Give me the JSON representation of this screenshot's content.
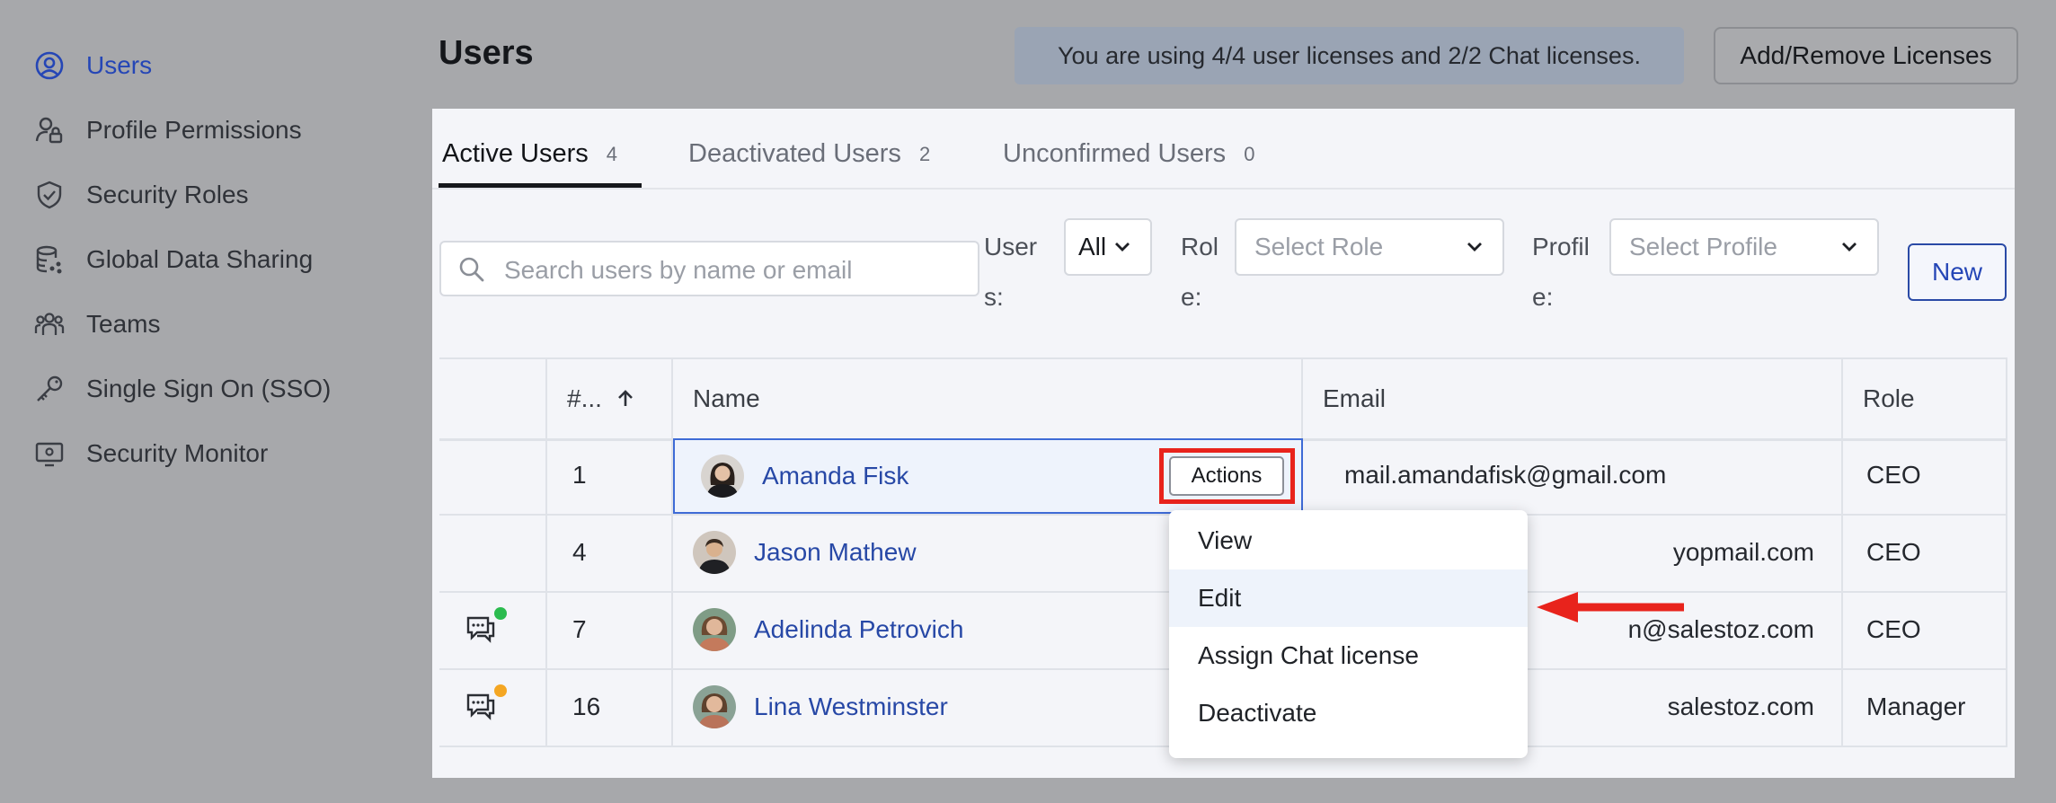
{
  "sidebar": {
    "items": [
      {
        "label": "Users",
        "icon": "user-circle-icon",
        "active": true
      },
      {
        "label": "Profile Permissions",
        "icon": "user-lock-icon"
      },
      {
        "label": "Security Roles",
        "icon": "shield-check-icon"
      },
      {
        "label": "Global Data Sharing",
        "icon": "database-share-icon"
      },
      {
        "label": "Teams",
        "icon": "team-icon"
      },
      {
        "label": "Single Sign On (SSO)",
        "icon": "key-icon"
      },
      {
        "label": "Security Monitor",
        "icon": "monitor-icon"
      }
    ]
  },
  "header": {
    "title": "Users",
    "license_note": "You are using 4/4 user licenses and 2/2 Chat licenses.",
    "license_button": "Add/Remove Licenses"
  },
  "tabs": [
    {
      "label": "Active Users",
      "count": "4"
    },
    {
      "label": "Deactivated Users",
      "count": "2"
    },
    {
      "label": "Unconfirmed Users",
      "count": "0"
    }
  ],
  "filters": {
    "search_placeholder": "Search users by name or email",
    "users_label_1": "User",
    "users_label_2": "s:",
    "users_value": "All",
    "role_label_1": "Rol",
    "role_label_2": "e:",
    "role_placeholder": "Select Role",
    "profile_label_1": "Profil",
    "profile_label_2": "e:",
    "profile_placeholder": "Select Profile",
    "new_button": "New"
  },
  "table": {
    "headers": {
      "num": "#...",
      "name": "Name",
      "email": "Email",
      "role": "Role"
    },
    "rows": [
      {
        "num": "1",
        "name": "Amanda Fisk",
        "email": "mail.amandafisk@gmail.com",
        "role": "CEO"
      },
      {
        "num": "4",
        "name": "Jason Mathew",
        "email": "yopmail.com",
        "role": "CEO"
      },
      {
        "num": "7",
        "name": "Adelinda Petrovich",
        "email": "n@salestoz.com",
        "role": "CEO",
        "chat_status": "green"
      },
      {
        "num": "16",
        "name": "Lina Westminster",
        "email": "salestoz.com",
        "role": "Manager",
        "chat_status": "orange"
      }
    ]
  },
  "actions_button": "Actions",
  "actions_menu": [
    "View",
    "Edit",
    "Assign Chat license",
    "Deactivate"
  ],
  "colors": {
    "link": "#2748a6",
    "highlight_red": "#e8231c",
    "status_green": "#2bbb4f",
    "status_orange": "#f4a623"
  }
}
